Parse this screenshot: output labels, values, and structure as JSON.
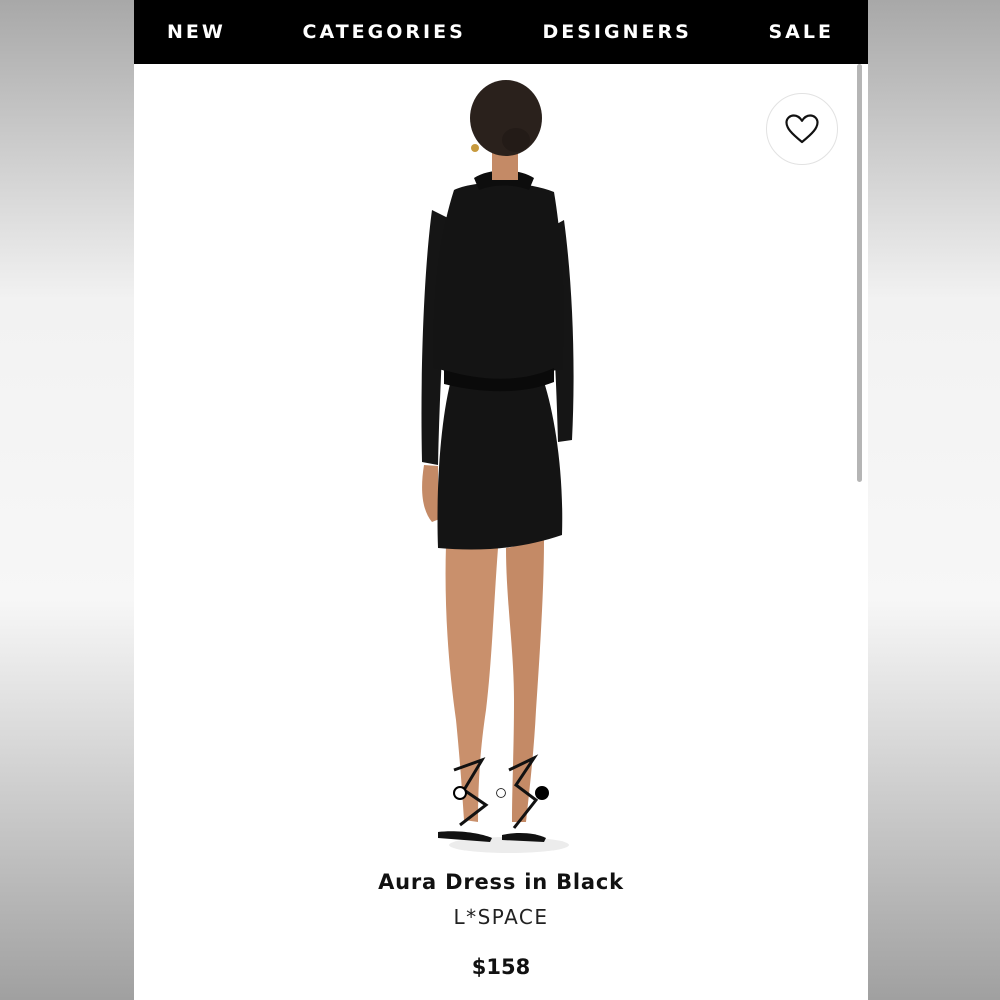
{
  "nav": {
    "items": [
      {
        "label": "NEW"
      },
      {
        "label": "CATEGORIES"
      },
      {
        "label": "DESIGNERS"
      },
      {
        "label": "SALE"
      }
    ]
  },
  "product": {
    "title": "Aura Dress in Black",
    "brand": "L*SPACE",
    "price": "$158",
    "image_count": 3,
    "active_image_index": 2
  },
  "icons": {
    "wishlist": "heart-icon"
  },
  "colors": {
    "nav_background": "#000000",
    "nav_text": "#ffffff",
    "page_background": "#ffffff"
  }
}
